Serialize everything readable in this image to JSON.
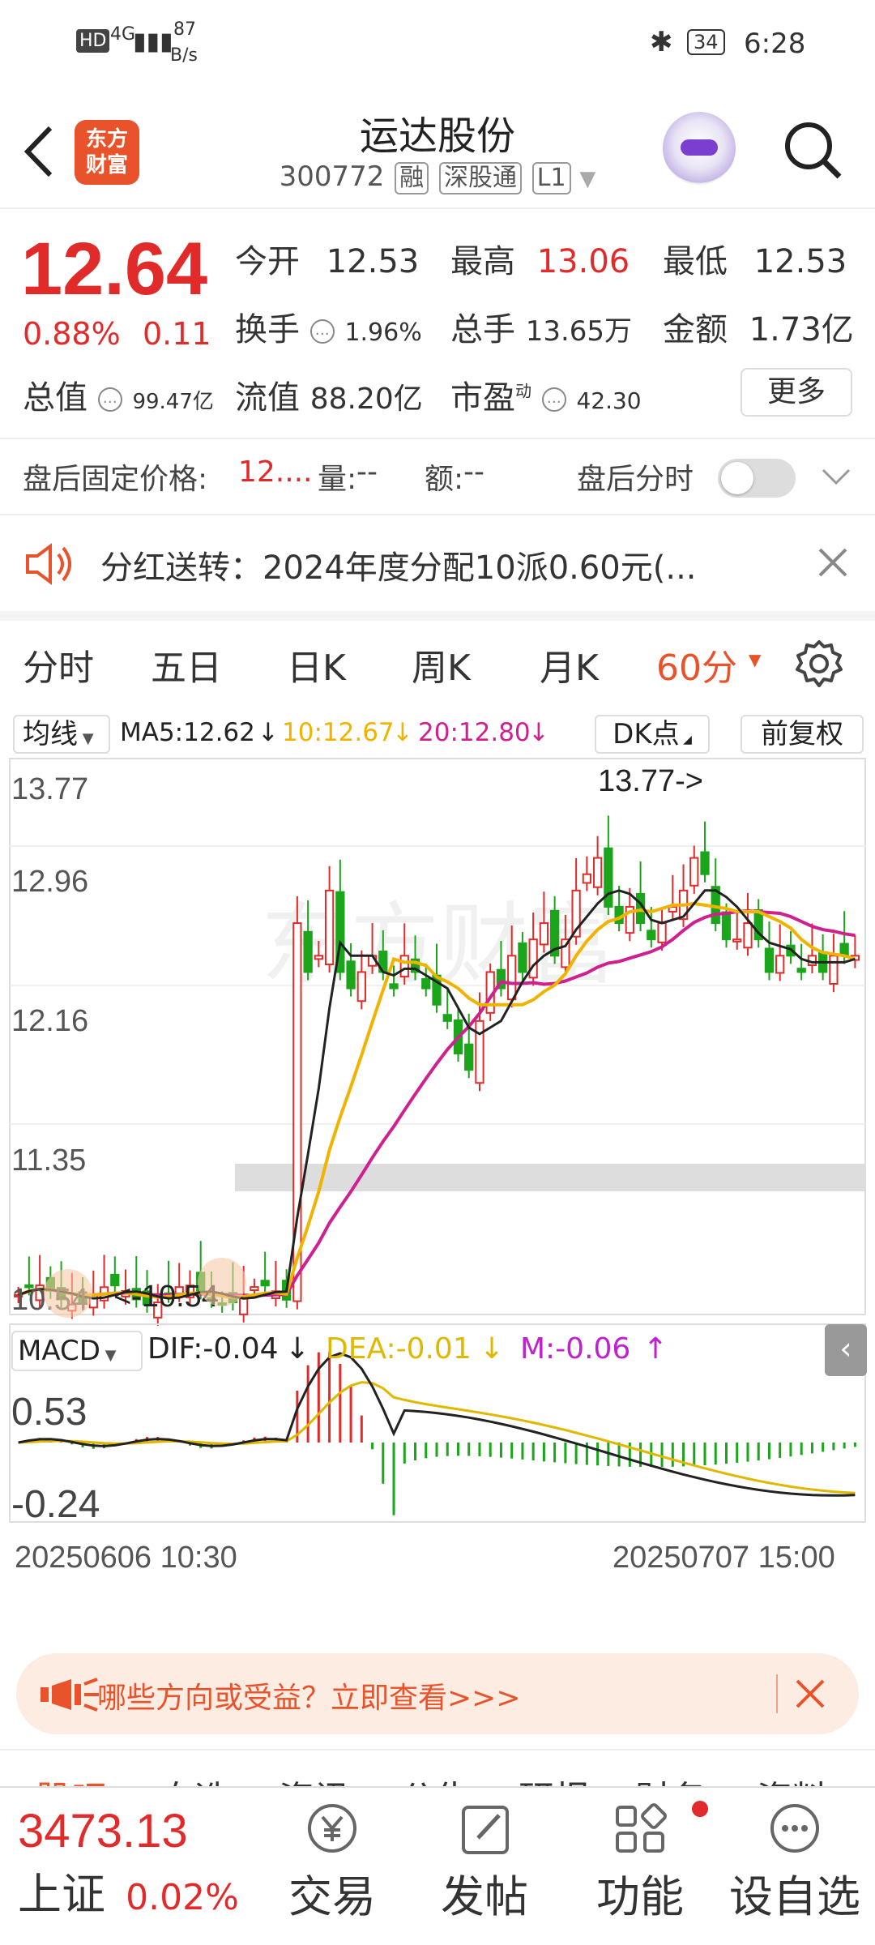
{
  "status": {
    "net_speed": "87",
    "net_unit": "B/s",
    "battery": "34",
    "time": "6:28",
    "hd": "HD",
    "signal": "4G"
  },
  "header": {
    "logo_line1": "东方",
    "logo_line2": "财富",
    "title": "运达股份",
    "code": "300772",
    "tag_rong": "融",
    "tag_sgt": "深股通",
    "tag_level": "L1"
  },
  "quote": {
    "price": "12.64",
    "change_pct": "0.88%",
    "change": "0.11",
    "open_label": "今开",
    "open": "12.53",
    "high_label": "最高",
    "high": "13.06",
    "low_label": "最低",
    "low": "12.53",
    "turnover_label": "换手",
    "turnover": "1.96%",
    "volume_label": "总手",
    "volume": "13.65万",
    "amount_label": "金额",
    "amount": "1.73亿",
    "mktcap_label": "总值",
    "mktcap": "99.47亿",
    "float_label": "流值",
    "float_cap": "88.20亿",
    "pe_label": "市盈",
    "pe_sup": "动",
    "pe": "42.30",
    "more_label": "更多"
  },
  "afterhours": {
    "price_label": "盘后固定价格:",
    "price": "12....",
    "vol_label": "量:",
    "vol": "--",
    "amt_label": "额:",
    "amt": "--",
    "toggle_label": "盘后分时"
  },
  "notice": {
    "text": "分红送转：2024年度分配10派0.60元(..."
  },
  "period_tabs": [
    "分时",
    "五日",
    "日K",
    "周K",
    "月K",
    "60分"
  ],
  "indicator_bar": {
    "ma_label": "均线",
    "ma5": "MA5:12.62",
    "ma10": "10:12.67",
    "ma20": "20:12.80",
    "dk_label": "DK点",
    "fq_label": "前复权"
  },
  "price_axis": [
    "13.77",
    "12.96",
    "12.16",
    "11.35",
    "10.54"
  ],
  "annotations": {
    "high_mark": "13.77->",
    "low_mark": "<-10.54"
  },
  "macd": {
    "label": "MACD",
    "dif": "DIF:-0.04",
    "dea": "DEA:-0.01",
    "m": "M:-0.06",
    "axis_top": "0.53",
    "axis_bottom": "-0.24"
  },
  "dates": {
    "start": "20250606 10:30",
    "end": "20250707 15:00"
  },
  "banner": {
    "text": "哪些方向或受益？立即查看>>>"
  },
  "bottom_tabs_partial": [
    "股吧",
    "自选",
    "资讯",
    "公告",
    "研报",
    "财务",
    "资料"
  ],
  "index": {
    "value": "3473.13",
    "name": "上证",
    "change": "0.02%"
  },
  "nav": {
    "trade": "交易",
    "post": "发帖",
    "func": "功能",
    "add": "设自选"
  },
  "colors": {
    "up": "#e12a2a",
    "down": "#1aa51a",
    "accent": "#e8532b",
    "ma5": "#222222",
    "ma10": "#f0b400",
    "ma20": "#d0208f"
  }
}
